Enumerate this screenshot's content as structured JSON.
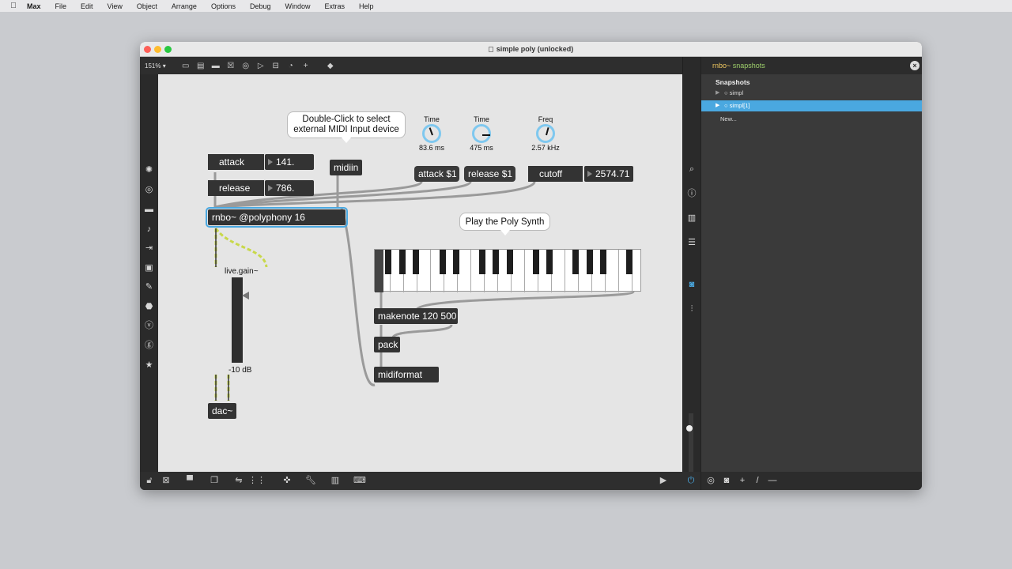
{
  "menubar": {
    "apple": "",
    "items": [
      "Max",
      "File",
      "Edit",
      "View",
      "Object",
      "Arrange",
      "Options",
      "Debug",
      "Window",
      "Extras",
      "Help"
    ]
  },
  "window": {
    "title": "simple poly (unlocked)",
    "zoom": "151%"
  },
  "patch": {
    "comment_midi": "Double-Click to select external MIDI Input device",
    "comment_play": "Play the Poly Synth",
    "attack_label": "attack",
    "attack_value": "141.",
    "release_label": "release",
    "release_value": "786.",
    "midiin": "midiin",
    "rnbo": "rnbo~ @polyphony 16",
    "dial_attack": {
      "title": "Time",
      "value": "83.6 ms"
    },
    "dial_release": {
      "title": "Time",
      "value": "475 ms"
    },
    "dial_freq": {
      "title": "Freq",
      "value": "2.57 kHz"
    },
    "msg_attack": "attack $1",
    "msg_release": "release $1",
    "cutoff_label": "cutoff",
    "cutoff_value": "2574.71",
    "gain_label": "live.gain~",
    "gain_value": "-10 dB",
    "dac": "dac~",
    "makenote": "makenote 120 500",
    "pack": "pack",
    "midiformat": "midiformat"
  },
  "snapshots": {
    "panel_title_prefix": "rnbo~",
    "panel_title_rest": " snapshots",
    "heading": "Snapshots",
    "items": [
      {
        "label": "simpl",
        "selected": false
      },
      {
        "label": "simpl[1]",
        "selected": true
      }
    ],
    "new_label": "New..."
  },
  "colors": {
    "canvas": "#e5e5e5",
    "object": "#333333",
    "dial_accent": "#7fc8ef",
    "selection": "#4aa8e0",
    "panel_title": "#f0c860",
    "signal_wire": "#c8d84a"
  }
}
